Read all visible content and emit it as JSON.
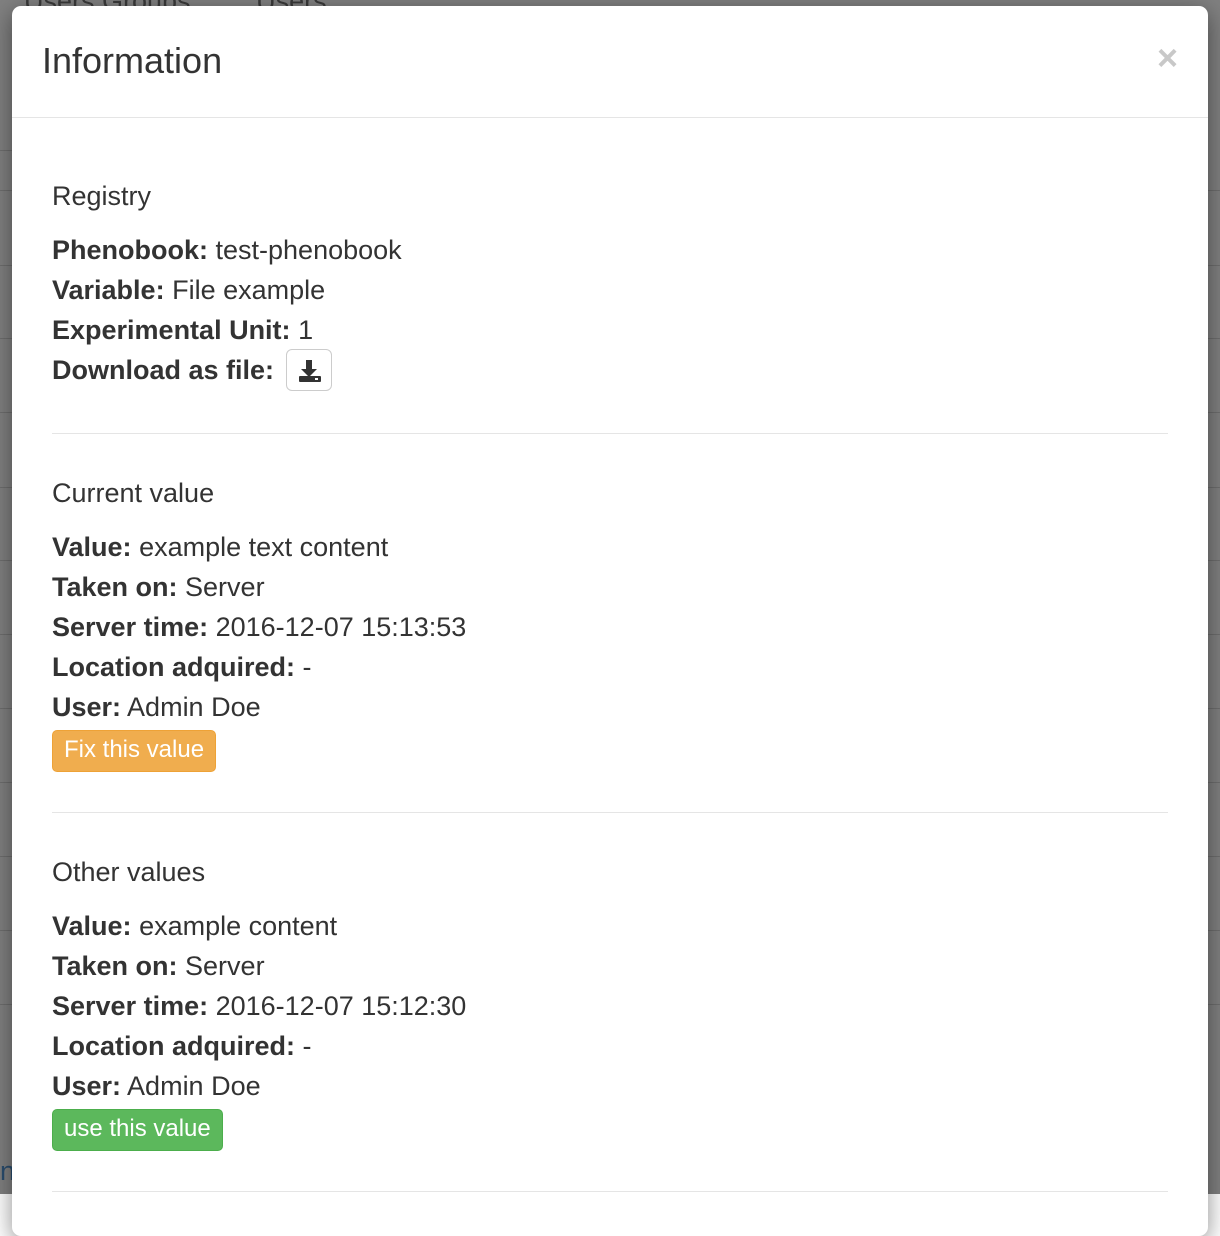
{
  "background": {
    "tabs": [
      "Users Groups",
      "Users"
    ],
    "bottom_text": "nt"
  },
  "modal": {
    "title": "Information",
    "close_symbol": "×"
  },
  "registry": {
    "title": "Registry",
    "phenobook_label": "Phenobook:",
    "phenobook_value": "test-phenobook",
    "variable_label": "Variable:",
    "variable_value": "File example",
    "unit_label": "Experimental Unit:",
    "unit_value": "1",
    "download_label": "Download as file:",
    "download_icon": "download-icon"
  },
  "current_value": {
    "title": "Current value",
    "value_label": "Value:",
    "value": "example text content",
    "taken_on_label": "Taken on:",
    "taken_on": "Server",
    "server_time_label": "Server time:",
    "server_time": "2016-12-07 15:13:53",
    "location_label": "Location adquired:",
    "location": "-",
    "user_label": "User:",
    "user": "Admin Doe",
    "button_label": "Fix this value",
    "button_color": "#f0ad4e"
  },
  "other_values": {
    "title": "Other values",
    "items": [
      {
        "value_label": "Value:",
        "value": "example content",
        "taken_on_label": "Taken on:",
        "taken_on": "Server",
        "server_time_label": "Server time:",
        "server_time": "2016-12-07 15:12:30",
        "location_label": "Location adquired:",
        "location": "-",
        "user_label": "User:",
        "user": "Admin Doe",
        "button_label": "use this value",
        "button_color": "#5cb85c"
      }
    ]
  }
}
